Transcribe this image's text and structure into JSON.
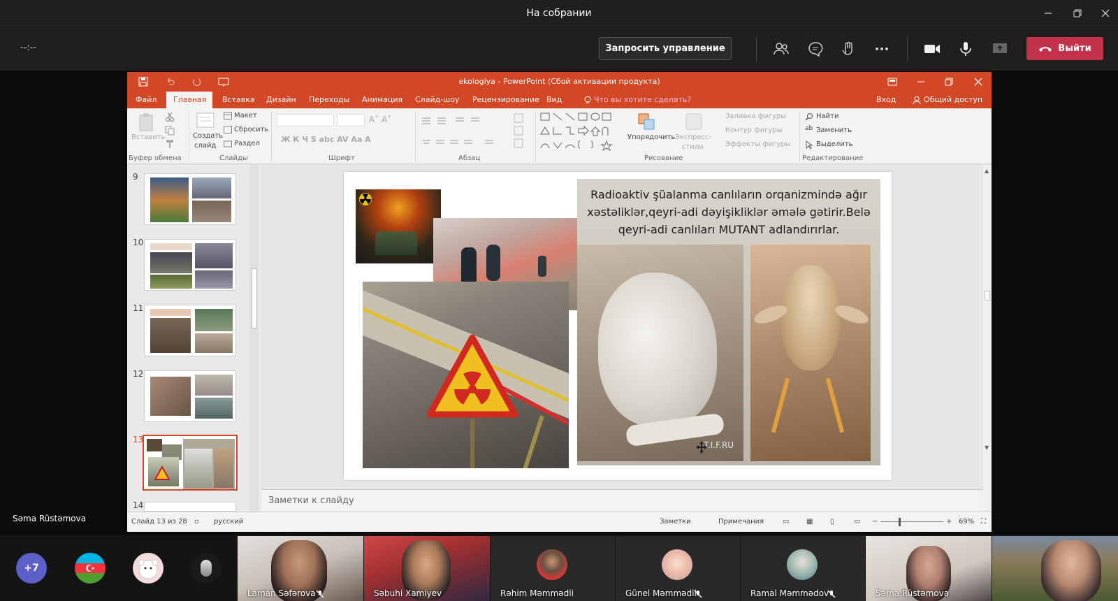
{
  "window": {
    "title": "На собрании"
  },
  "toolbar": {
    "timer": "--:--",
    "request_control": "Запросить управление",
    "leave": "Выйти"
  },
  "presenter": {
    "name": "Səma Rüstəmova"
  },
  "ppt": {
    "title": "ekologiya - PowerPoint (Сбой активации продукта)",
    "tabs": [
      "Файл",
      "Главная",
      "Вставка",
      "Дизайн",
      "Переходы",
      "Анимация",
      "Слайд-шоу",
      "Рецензирование",
      "Вид",
      "Что вы хотите сделать?"
    ],
    "signin": "Вход",
    "share": "Общий доступ",
    "ribbon": {
      "paste": "Вставить",
      "new_slide_1": "Создать",
      "new_slide_2": "слайд",
      "layout": "Макет",
      "reset": "Сбросить",
      "section": "Раздел",
      "arrange": "Упорядочить",
      "quick_styles_1": "Экспресс-",
      "quick_styles_2": "стили",
      "shape_fill": "Заливка фигуры",
      "shape_outline": "Контур фигуры",
      "shape_effects": "Эффекты фигуры",
      "find": "Найти",
      "replace": "Заменить",
      "select": "Выделить",
      "groups": {
        "clipboard": "Буфер обмена",
        "slides": "Слайды",
        "font": "Шрифт",
        "paragraph": "Абзац",
        "drawing": "Рисование",
        "editing": "Редактирование"
      }
    },
    "thumb_numbers": [
      "9",
      "10",
      "11",
      "12",
      "13",
      "14"
    ],
    "slide": {
      "caption": "Radioaktiv şüalanma canlıların orqanizmində ağır xəstəliklər,qeyri-adi dəyişikliklər əmələ gətirir.Belə qeyri-adi canlıları MUTANT adlandırırlar.",
      "watermark": "T.I.F.RU"
    },
    "notes_placeholder": "Заметки к слайду",
    "status": {
      "slide_of": "Слайд 13 из 28",
      "language": "русский",
      "notes": "Заметки",
      "comments": "Примечания",
      "zoom": "69%"
    }
  },
  "participants": {
    "overflow": "+7",
    "tiles": [
      {
        "name": "Laman Səfərova"
      },
      {
        "name": "Səbuhi Xamiyev"
      },
      {
        "name": "Rəhim Məmmədli"
      },
      {
        "name": "Günel Məmmədli"
      },
      {
        "name": "Ramal Məmmədov"
      },
      {
        "name": "Səma Rüstəmova"
      }
    ]
  }
}
